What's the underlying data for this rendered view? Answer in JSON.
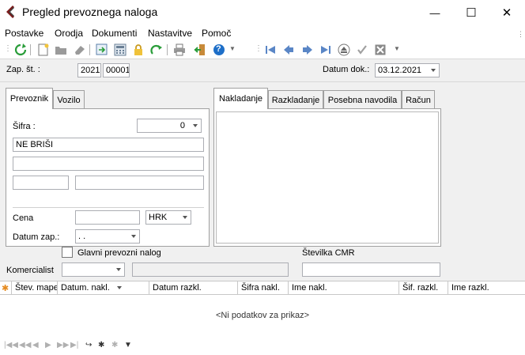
{
  "window": {
    "title": "Pregled prevoznega naloga",
    "min_glyph": "—",
    "max_glyph": "☐",
    "close_glyph": "✕"
  },
  "menu": [
    "Postavke",
    "Orodja",
    "Dokumenti",
    "Nastavitve",
    "Pomoč"
  ],
  "toolbar": {
    "help_glyph": "?",
    "icons": [
      "refresh-icon",
      "new-document-icon",
      "folder-icon",
      "eraser-icon",
      "export-icon",
      "calculator-icon",
      "lock-icon",
      "redo-icon",
      "print-icon",
      "exit-icon",
      "help-icon",
      "first-record-icon",
      "previous-record-icon",
      "next-record-icon",
      "last-record-icon",
      "eject-icon",
      "check-icon",
      "cancel-icon"
    ]
  },
  "header": {
    "zap_label": "Zap. št. :",
    "year": "2021",
    "number": "00001",
    "date_label": "Datum dok.:",
    "date_value": "03.12.2021"
  },
  "left_tabs": [
    "Prevoznik",
    "Vozilo"
  ],
  "left_panel": {
    "sifra_label": "Šifra :",
    "sifra_value": "0",
    "name_value": "NE BRIŠI",
    "cena_label": "Cena",
    "currency": "HRK",
    "datum_zap_label": "Datum zap.:",
    "datum_zap_value": ". ."
  },
  "right_tabs": [
    "Nakladanje",
    "Razkladanje",
    "Posebna navodila",
    "Račun"
  ],
  "bottom": {
    "glavni_label": "Glavni prevozni nalog",
    "cmr_label": "Številka CMR",
    "komercialist_label": "Komercialist"
  },
  "grid": {
    "columns": [
      "Štev. mape",
      "Datum. nakl.",
      "Datum razkl.",
      "Šifra nakl.",
      "Ime nakl.",
      "Šif. razkl.",
      "Ime razkl."
    ],
    "empty_text": "<Ni podatkov za prikaz>"
  },
  "colors": {
    "accent": "#1e6fc8",
    "panel_bg": "#f0f0f0",
    "border": "#abadb3"
  }
}
